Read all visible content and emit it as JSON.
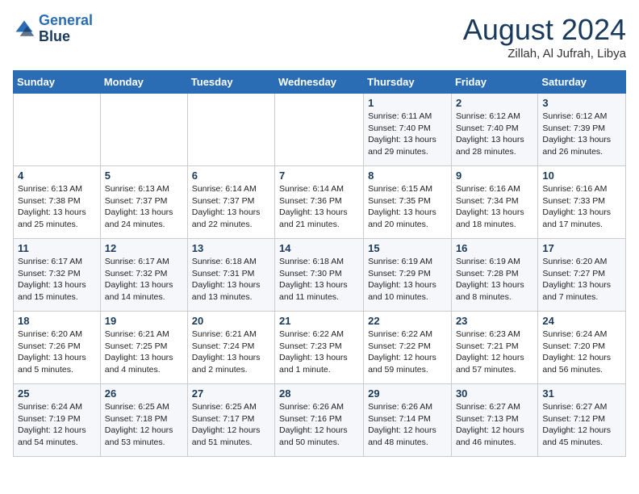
{
  "header": {
    "logo_line1": "General",
    "logo_line2": "Blue",
    "month_year": "August 2024",
    "location": "Zillah, Al Jufrah, Libya"
  },
  "weekdays": [
    "Sunday",
    "Monday",
    "Tuesday",
    "Wednesday",
    "Thursday",
    "Friday",
    "Saturday"
  ],
  "weeks": [
    [
      {
        "day": "",
        "info": ""
      },
      {
        "day": "",
        "info": ""
      },
      {
        "day": "",
        "info": ""
      },
      {
        "day": "",
        "info": ""
      },
      {
        "day": "1",
        "info": "Sunrise: 6:11 AM\nSunset: 7:40 PM\nDaylight: 13 hours\nand 29 minutes."
      },
      {
        "day": "2",
        "info": "Sunrise: 6:12 AM\nSunset: 7:40 PM\nDaylight: 13 hours\nand 28 minutes."
      },
      {
        "day": "3",
        "info": "Sunrise: 6:12 AM\nSunset: 7:39 PM\nDaylight: 13 hours\nand 26 minutes."
      }
    ],
    [
      {
        "day": "4",
        "info": "Sunrise: 6:13 AM\nSunset: 7:38 PM\nDaylight: 13 hours\nand 25 minutes."
      },
      {
        "day": "5",
        "info": "Sunrise: 6:13 AM\nSunset: 7:37 PM\nDaylight: 13 hours\nand 24 minutes."
      },
      {
        "day": "6",
        "info": "Sunrise: 6:14 AM\nSunset: 7:37 PM\nDaylight: 13 hours\nand 22 minutes."
      },
      {
        "day": "7",
        "info": "Sunrise: 6:14 AM\nSunset: 7:36 PM\nDaylight: 13 hours\nand 21 minutes."
      },
      {
        "day": "8",
        "info": "Sunrise: 6:15 AM\nSunset: 7:35 PM\nDaylight: 13 hours\nand 20 minutes."
      },
      {
        "day": "9",
        "info": "Sunrise: 6:16 AM\nSunset: 7:34 PM\nDaylight: 13 hours\nand 18 minutes."
      },
      {
        "day": "10",
        "info": "Sunrise: 6:16 AM\nSunset: 7:33 PM\nDaylight: 13 hours\nand 17 minutes."
      }
    ],
    [
      {
        "day": "11",
        "info": "Sunrise: 6:17 AM\nSunset: 7:32 PM\nDaylight: 13 hours\nand 15 minutes."
      },
      {
        "day": "12",
        "info": "Sunrise: 6:17 AM\nSunset: 7:32 PM\nDaylight: 13 hours\nand 14 minutes."
      },
      {
        "day": "13",
        "info": "Sunrise: 6:18 AM\nSunset: 7:31 PM\nDaylight: 13 hours\nand 13 minutes."
      },
      {
        "day": "14",
        "info": "Sunrise: 6:18 AM\nSunset: 7:30 PM\nDaylight: 13 hours\nand 11 minutes."
      },
      {
        "day": "15",
        "info": "Sunrise: 6:19 AM\nSunset: 7:29 PM\nDaylight: 13 hours\nand 10 minutes."
      },
      {
        "day": "16",
        "info": "Sunrise: 6:19 AM\nSunset: 7:28 PM\nDaylight: 13 hours\nand 8 minutes."
      },
      {
        "day": "17",
        "info": "Sunrise: 6:20 AM\nSunset: 7:27 PM\nDaylight: 13 hours\nand 7 minutes."
      }
    ],
    [
      {
        "day": "18",
        "info": "Sunrise: 6:20 AM\nSunset: 7:26 PM\nDaylight: 13 hours\nand 5 minutes."
      },
      {
        "day": "19",
        "info": "Sunrise: 6:21 AM\nSunset: 7:25 PM\nDaylight: 13 hours\nand 4 minutes."
      },
      {
        "day": "20",
        "info": "Sunrise: 6:21 AM\nSunset: 7:24 PM\nDaylight: 13 hours\nand 2 minutes."
      },
      {
        "day": "21",
        "info": "Sunrise: 6:22 AM\nSunset: 7:23 PM\nDaylight: 13 hours\nand 1 minute."
      },
      {
        "day": "22",
        "info": "Sunrise: 6:22 AM\nSunset: 7:22 PM\nDaylight: 12 hours\nand 59 minutes."
      },
      {
        "day": "23",
        "info": "Sunrise: 6:23 AM\nSunset: 7:21 PM\nDaylight: 12 hours\nand 57 minutes."
      },
      {
        "day": "24",
        "info": "Sunrise: 6:24 AM\nSunset: 7:20 PM\nDaylight: 12 hours\nand 56 minutes."
      }
    ],
    [
      {
        "day": "25",
        "info": "Sunrise: 6:24 AM\nSunset: 7:19 PM\nDaylight: 12 hours\nand 54 minutes."
      },
      {
        "day": "26",
        "info": "Sunrise: 6:25 AM\nSunset: 7:18 PM\nDaylight: 12 hours\nand 53 minutes."
      },
      {
        "day": "27",
        "info": "Sunrise: 6:25 AM\nSunset: 7:17 PM\nDaylight: 12 hours\nand 51 minutes."
      },
      {
        "day": "28",
        "info": "Sunrise: 6:26 AM\nSunset: 7:16 PM\nDaylight: 12 hours\nand 50 minutes."
      },
      {
        "day": "29",
        "info": "Sunrise: 6:26 AM\nSunset: 7:14 PM\nDaylight: 12 hours\nand 48 minutes."
      },
      {
        "day": "30",
        "info": "Sunrise: 6:27 AM\nSunset: 7:13 PM\nDaylight: 12 hours\nand 46 minutes."
      },
      {
        "day": "31",
        "info": "Sunrise: 6:27 AM\nSunset: 7:12 PM\nDaylight: 12 hours\nand 45 minutes."
      }
    ]
  ]
}
